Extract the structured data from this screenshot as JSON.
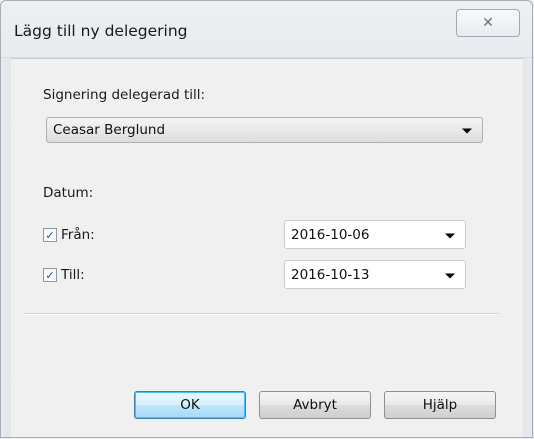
{
  "window": {
    "title": "Lägg till ny delegering",
    "close_icon": "close-icon"
  },
  "signing": {
    "label": "Signering delegerad till:",
    "selected": "Ceasar Berglund"
  },
  "date": {
    "label": "Datum:",
    "from": {
      "checked": true,
      "label": "Från:",
      "value": "2016-10-06"
    },
    "to": {
      "checked": true,
      "label": "Till:",
      "value": "2016-10-13"
    }
  },
  "buttons": {
    "ok": "OK",
    "cancel": "Avbryt",
    "help": "Hjälp"
  },
  "glyphs": {
    "check": "✓",
    "close": "✕"
  },
  "colors": {
    "default_button": "#bee6fd",
    "checkmark": "#2b4c8c"
  }
}
